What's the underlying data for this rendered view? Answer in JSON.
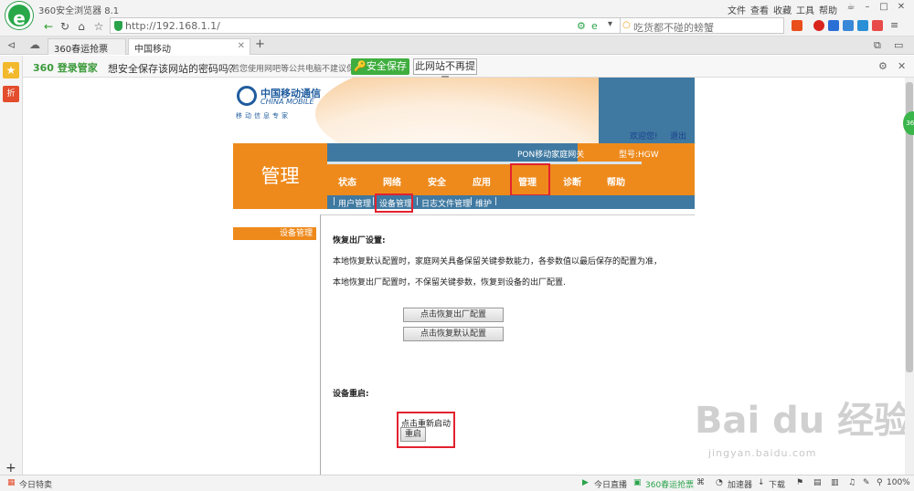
{
  "browser": {
    "app_title": "360安全浏览器 8.1",
    "menu": [
      "文件",
      "查看",
      "收藏",
      "工具",
      "帮助"
    ],
    "url": "http://192.168.1.1/",
    "search_placeholder": "吃货都不碰的螃蟹",
    "tabs": [
      {
        "label": "360春运抢票"
      },
      {
        "label": "中国移动"
      }
    ],
    "password_bar": {
      "brand": "360 登录管家",
      "prompt": "想安全保存该网站的密码吗？",
      "note": "（若您使用网吧等公共电脑不建议保存）",
      "save_label": "安全保存",
      "no_more_label": "此网站不再提示"
    },
    "sidebar": {
      "gift_label": "折",
      "add_label": "+"
    },
    "status": {
      "left": "今日特卖",
      "live": "今日直播",
      "train": "360春运抢票",
      "accelerator": "加速器",
      "download": "下载",
      "zoom": "100%"
    }
  },
  "router": {
    "brand_cn": "中国移动通信",
    "brand_en": "CHINA MOBILE",
    "slogan": "移动信息专家",
    "welcome": "欢迎您!",
    "logout": "退出",
    "pon_label": "PON移动家庭网关",
    "model": "型号:HGW",
    "section_title": "管理",
    "nav": [
      "状态",
      "网络",
      "安全",
      "应用",
      "管理",
      "诊断",
      "帮助"
    ],
    "subnav": [
      "用户管理",
      "设备管理",
      "日志文件管理",
      "维护"
    ],
    "left_menu": "设备管理",
    "content": {
      "restore_title": "恢复出厂设置:",
      "restore_line1": "本地恢复默认配置时，家庭网关具备保留关键参数能力，各参数值以最后保存的配置为准，",
      "restore_line2": "本地恢复出厂配置时，不保留关键参数，恢复到设备的出厂配置.",
      "restore_factory_btn": "点击恢复出厂配置",
      "restore_default_btn": "点击恢复默认配置",
      "reboot_title": "设备重启:",
      "reboot_hint": "点击重新启动",
      "reboot_btn": "重启"
    }
  },
  "watermark": {
    "brand": "Bai du 经验",
    "url": "jingyan.baidu.com"
  },
  "colors": {
    "orange": "#ee8a1c",
    "blue": "#3f79a1",
    "red_highlight": "#e3222e",
    "green": "#3fae3f"
  }
}
